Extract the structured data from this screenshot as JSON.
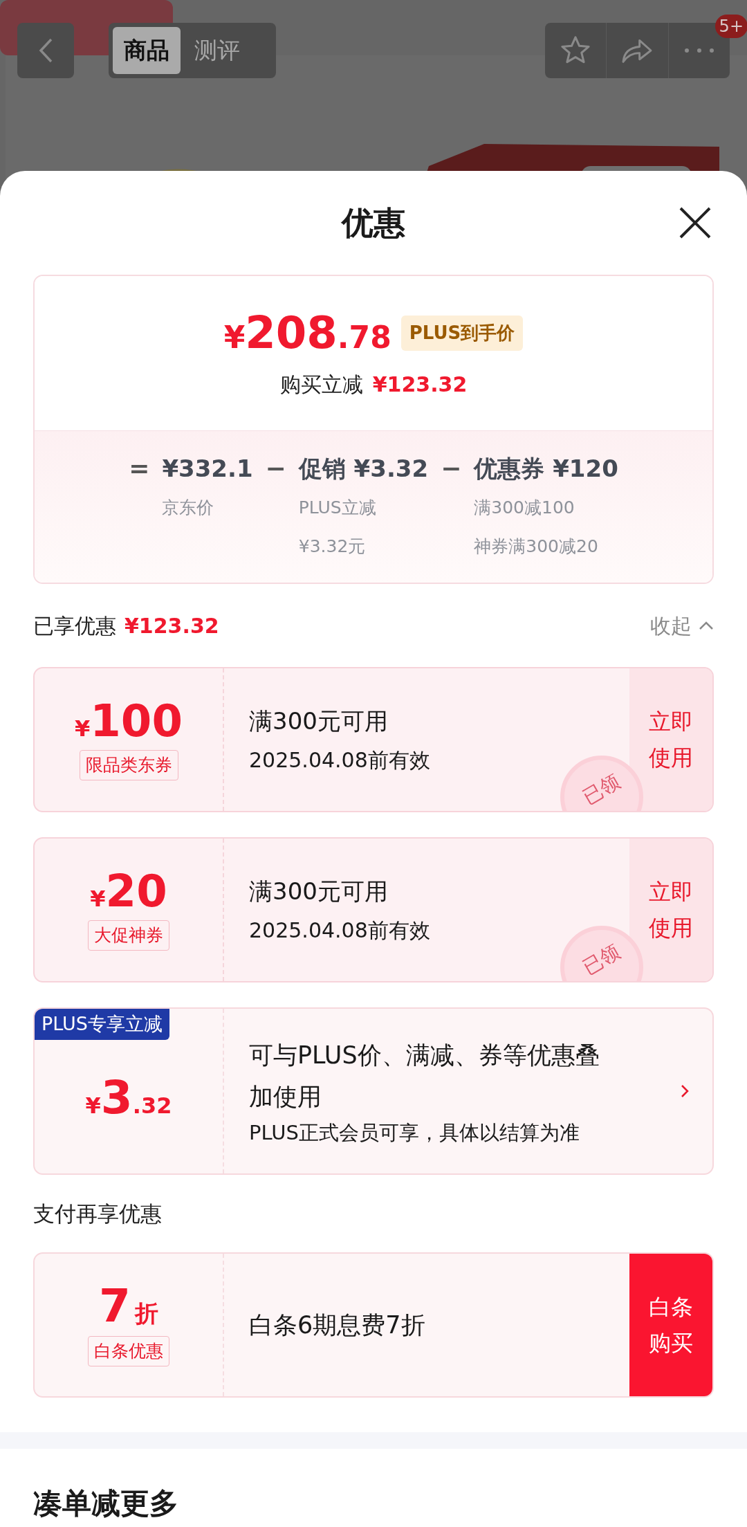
{
  "header": {
    "tabs": [
      {
        "label": "商品",
        "selected": true
      },
      {
        "label": "测评",
        "selected": false
      }
    ],
    "badge": "5+"
  },
  "sheet": {
    "title": "优惠"
  },
  "price_summary": {
    "currency": "¥",
    "integer": "208",
    "decimal": ".78",
    "tag": "PLUS到手价",
    "saving_label": "购买立减",
    "saving": "¥123.32",
    "breakdown": [
      {
        "operator": "=",
        "amount": "¥332.1",
        "notes": [
          "京东价"
        ]
      },
      {
        "operator": "−",
        "label": "促销",
        "amount": "¥3.32",
        "notes": [
          "PLUS立减",
          "¥3.32元"
        ]
      },
      {
        "operator": "−",
        "label": "优惠券",
        "amount": "¥120",
        "notes": [
          "满300减100",
          "神券满300减20"
        ]
      }
    ]
  },
  "applied": {
    "label": "已享优惠",
    "amount": "¥123.32",
    "toggle": "收起",
    "expanded": true
  },
  "offers": [
    {
      "kind": "coupon",
      "currency": "¥",
      "amount": "100",
      "tag": "限品类东券",
      "condition": "满300元可用",
      "validity": "2025.04.08前有效",
      "action": "立即使用",
      "stamp": "已领"
    },
    {
      "kind": "coupon",
      "currency": "¥",
      "amount": "20",
      "tag": "大促神券",
      "condition": "满300元可用",
      "validity": "2025.04.08前有效",
      "action": "立即使用",
      "stamp": "已领"
    },
    {
      "kind": "plus",
      "ribbon": "PLUS专享立减",
      "currency": "¥",
      "integer": "3",
      "decimal": ".32",
      "description": "可与PLUS价、满减、券等优惠叠加使用",
      "note": "PLUS正式会员可享，具体以结算为准"
    }
  ],
  "payment": {
    "title": "支付再享优惠",
    "offers": [
      {
        "value": "7",
        "unit": "折",
        "tag": "白条优惠",
        "description": "白条6期息费7折",
        "action": "白条购买"
      }
    ]
  },
  "more": {
    "title": "凑单减更多"
  }
}
